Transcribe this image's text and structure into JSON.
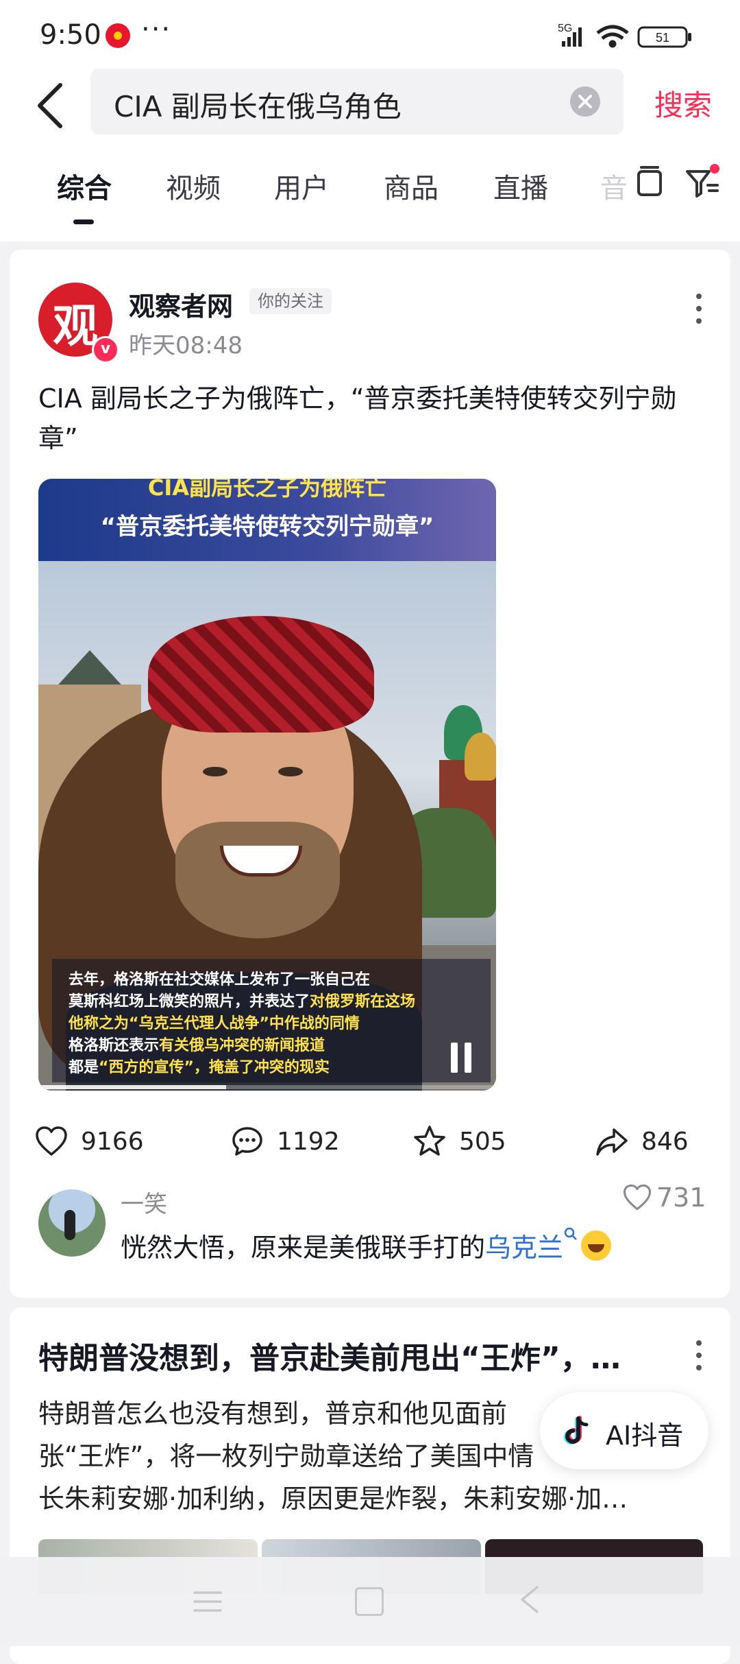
{
  "status_bar": {
    "time": "9:50",
    "more": "···",
    "network": "5G",
    "battery": "51",
    "icons": [
      "weibo-icon",
      "signal-icon",
      "wifi-icon",
      "battery-icon"
    ]
  },
  "header": {
    "search_query": "CIA 副局长在俄乌角色",
    "search_button": "搜索",
    "icons": [
      "back-icon",
      "clear-icon"
    ]
  },
  "tabs": {
    "items": [
      "综合",
      "视频",
      "用户",
      "商品",
      "直播"
    ],
    "faded": "音",
    "active": "综合",
    "icons": [
      "device-icon",
      "filter-icon"
    ]
  },
  "post": {
    "author": "观察者网",
    "avatar_char": "观",
    "verified": "v",
    "follow_badge": "你的关注",
    "time": "昨天08:48",
    "title": "CIA 副局长之子为俄阵亡，“普京委托美特使转交列宁勋章”",
    "video": {
      "banner_top": "CIA副局长之子为俄阵亡",
      "banner_main": "“普京委托美特使转交列宁勋章”",
      "subtitle_lines": [
        {
          "plain": "去年，格洛斯在社交媒体上发布了一张自己在",
          "highlight": ""
        },
        {
          "plain": "莫斯科红场上微笑的照片，并表达了",
          "highlight": "对俄罗斯在这场"
        },
        {
          "plain": "",
          "highlight": "他称之为“乌克兰代理人战争”中作战的同情"
        },
        {
          "plain": "格洛斯还表示",
          "highlight": "有关俄乌冲突的新闻报道"
        },
        {
          "plain": "都是",
          "highlight": "“西方的宣传”，掩盖了冲突的现实"
        }
      ],
      "progress": 0.41
    },
    "actions": {
      "likes": "9166",
      "comments": "1192",
      "favorites": "505",
      "shares": "846"
    },
    "top_comment": {
      "user": "一笑",
      "likes": "731",
      "text": "恍然大悟，原来是美俄联手打的",
      "link": "乌克兰"
    }
  },
  "post2": {
    "title": "特朗普没想到，普京赴美前甩出“王炸”，…",
    "body_lines": [
      "特朗普怎么也没有想到，普京和他见面前",
      "张“王炸”，将一枚列宁勋章送给了美国中情",
      "长朱莉安娜·加利纳，原因更是炸裂，朱莉安娜·加…"
    ]
  },
  "ai_button": {
    "label": "AI抖音"
  },
  "colors": {
    "accent": "#fe2c55",
    "link": "#2b6fd4",
    "muted": "#8a8a93"
  }
}
